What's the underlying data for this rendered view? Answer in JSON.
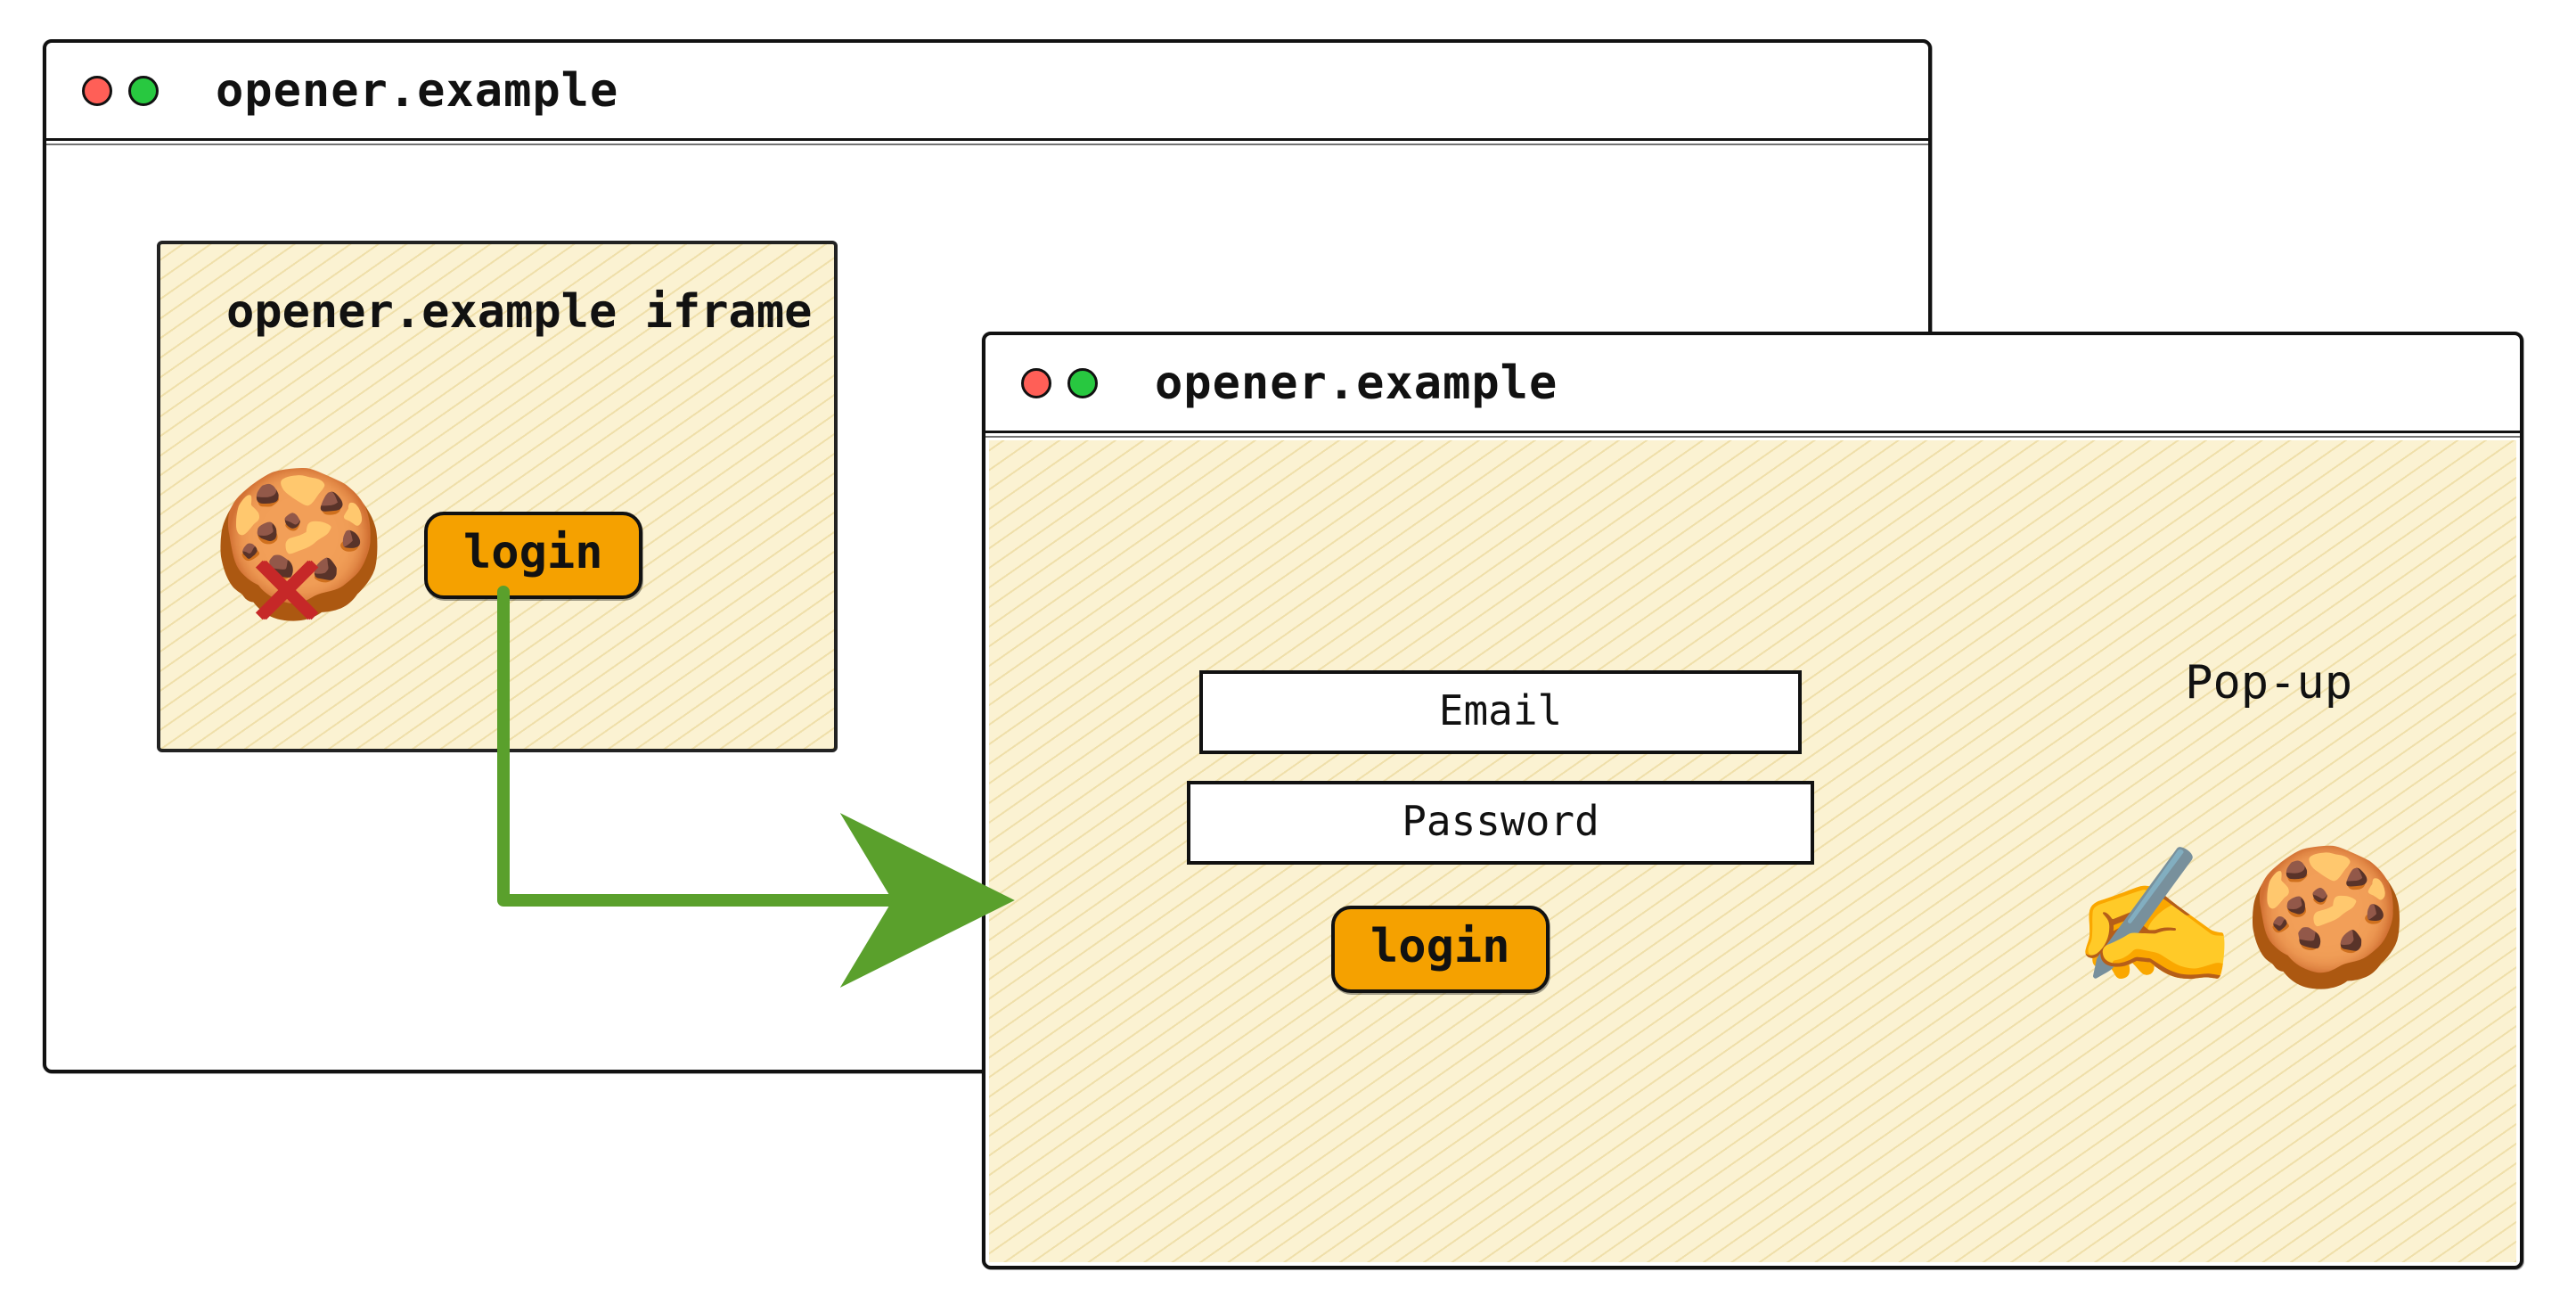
{
  "opener_window": {
    "title": "opener.example",
    "iframe": {
      "title": "opener.example iframe",
      "cookie_icon": "🍪",
      "blocked_icon": "✕",
      "login_button_label": "login"
    }
  },
  "popup_window": {
    "title": "opener.example",
    "label": "Pop-up",
    "form": {
      "email_placeholder": "Email",
      "password_placeholder": "Password",
      "login_button_label": "login"
    },
    "write_icon": "✍️",
    "cookie_icon": "🍪"
  },
  "colors": {
    "accent_orange": "#f5a100",
    "arrow_green": "#5aa02c",
    "cross_red": "#c62828",
    "hatched_bg": "#fbf2d2"
  }
}
